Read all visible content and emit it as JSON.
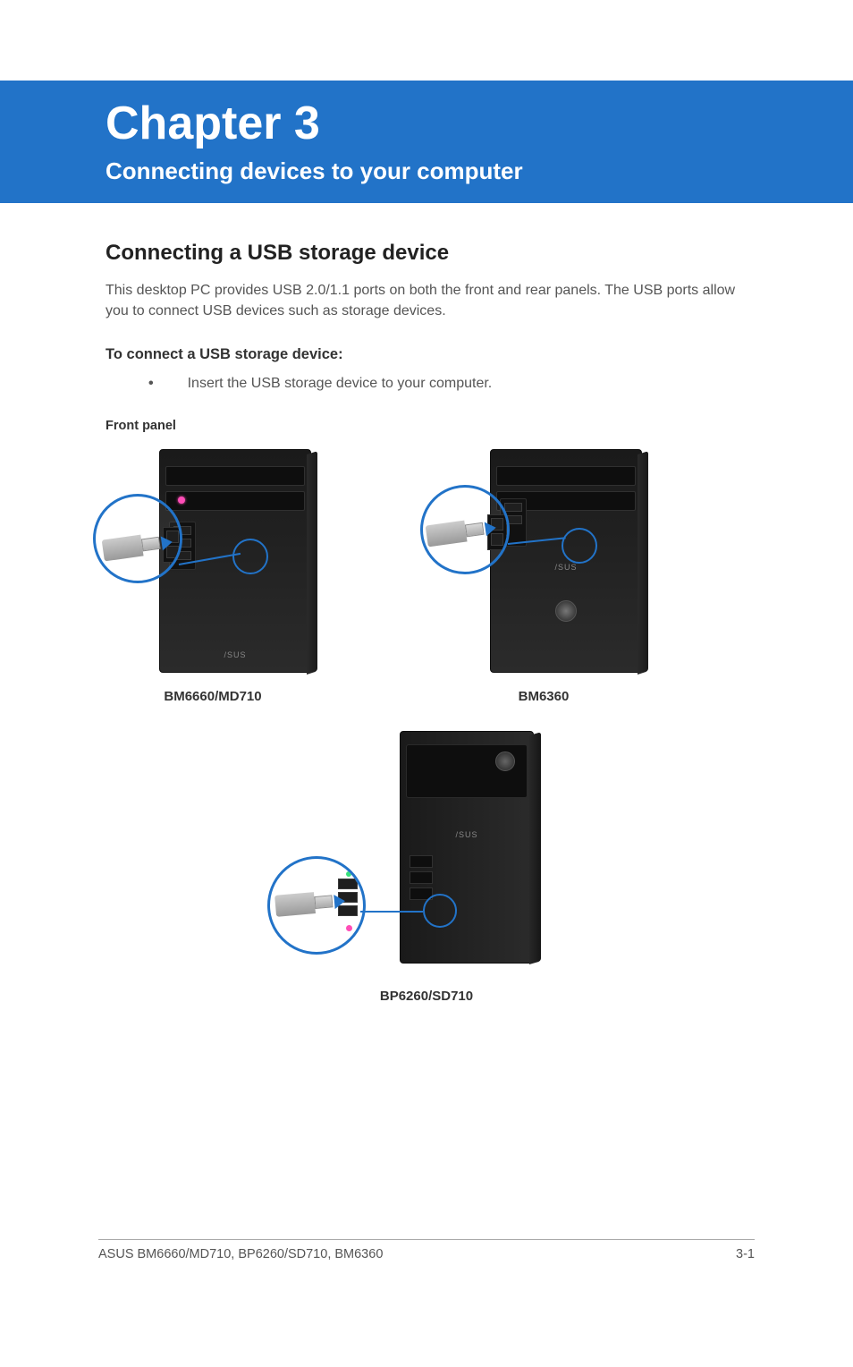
{
  "banner": {
    "chapter": "Chapter 3",
    "subtitle": "Connecting devices to your computer"
  },
  "section": {
    "heading": "Connecting a USB storage device",
    "intro": "This desktop PC provides USB 2.0/1.1 ports on both the front and rear panels. The USB ports allow you to connect USB devices such as storage devices.",
    "subheading": "To connect a USB storage device:",
    "bullet_symbol": "•",
    "bullet_text": "Insert the USB storage device to your computer.",
    "panel_label": "Front panel"
  },
  "devices": {
    "model_a": "BM6660/MD710",
    "model_b": "BM6360",
    "model_c": "BP6260/SD710",
    "logo_text": "/SUS"
  },
  "footer": {
    "left": "ASUS BM6660/MD710, BP6260/SD710, BM6360",
    "right": "3-1"
  }
}
